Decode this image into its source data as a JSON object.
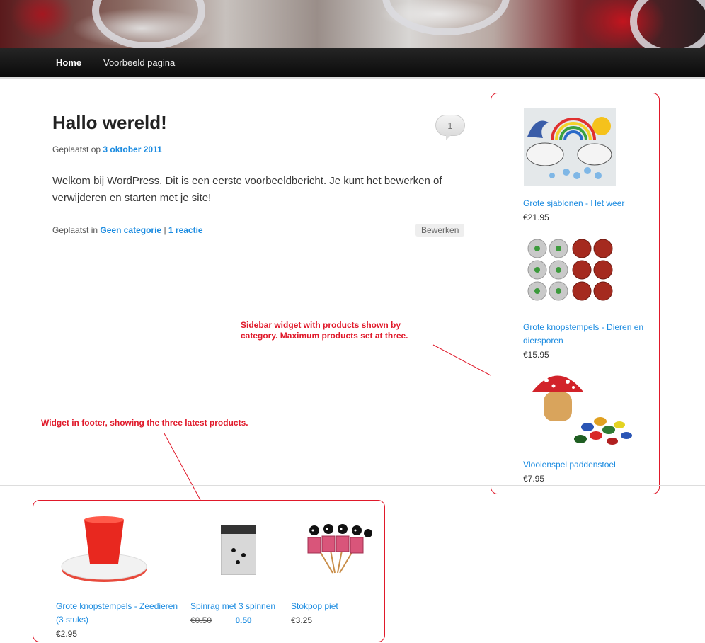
{
  "nav": {
    "home": "Home",
    "sample_page": "Voorbeeld pagina"
  },
  "post": {
    "title": "Hallo wereld!",
    "comment_count": "1",
    "posted_on_label": "Geplaatst op",
    "date": "3 oktober 2011",
    "body": "Welkom bij WordPress. Dit is een eerste voorbeeldbericht. Je kunt het bewerken of verwijderen en starten met je site!",
    "posted_in_label": "Geplaatst in",
    "category": "Geen categorie",
    "separator": "|",
    "comments_link": "1 reactie",
    "edit_label": "Bewerken"
  },
  "annotations": {
    "sidebar": "Sidebar widget with products shown by category. Maximum products set at three.",
    "footer": "Widget in footer, showing the three latest products."
  },
  "sidebar_products": [
    {
      "name": "Grote sjablonen - Het weer",
      "price": "€21.95"
    },
    {
      "name": "Grote knopstempels - Dieren en diersporen",
      "price": "€15.95"
    },
    {
      "name": "Vlooienspel paddenstoel",
      "price": "€7.95"
    }
  ],
  "footer_products": [
    {
      "name": "Grote knopstempels - Zeedieren (3 stuks)",
      "price": "€2.95"
    },
    {
      "name": "Spinrag met 3 spinnen",
      "old_price": "€0.50",
      "sale_price": "0.50"
    },
    {
      "name": "Stokpop piet",
      "price": "€3.25"
    }
  ],
  "colors": {
    "link": "#1b8be0",
    "annotation": "#e0192a",
    "nav_bg": "#111111"
  }
}
